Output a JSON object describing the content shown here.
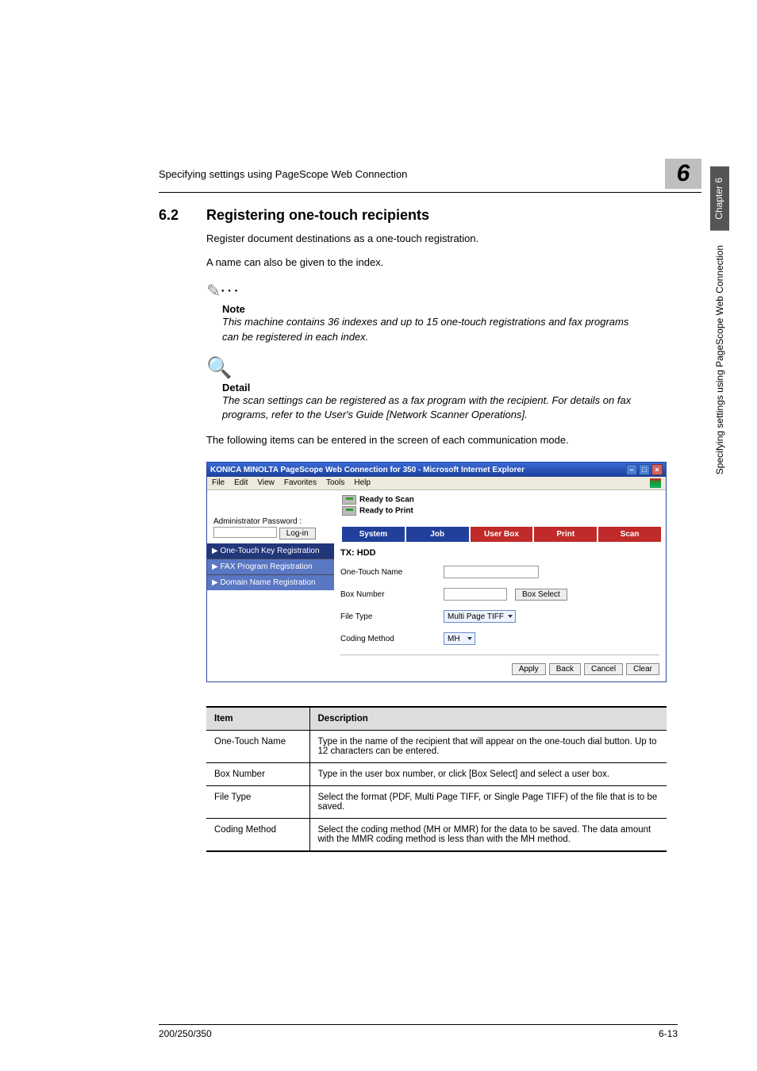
{
  "header": {
    "left": "Specifying settings using PageScope Web Connection",
    "chapter_num": "6"
  },
  "side": {
    "dark": "Chapter 6",
    "light": "Specifying settings using PageScope Web Connection"
  },
  "section": {
    "num": "6.2",
    "title": "Registering one-touch recipients"
  },
  "body1": "Register document destinations as a one-touch registration.",
  "body2": "A name can also be given to the index.",
  "note": {
    "head": "Note",
    "body": "This machine contains 36 indexes and up to 15 one-touch registrations and fax programs can be registered in each index."
  },
  "detail": {
    "head": "Detail",
    "body": "The scan settings can be registered as a fax program with the recipient. For details on fax programs, refer to the User's Guide [Network Scanner Operations]."
  },
  "body3": "The following items can be entered in the screen of each communication mode.",
  "browser": {
    "title": "KONICA MINOLTA PageScope Web Connection for 350 - Microsoft Internet Explorer",
    "menu": [
      "File",
      "Edit",
      "View",
      "Favorites",
      "Tools",
      "Help"
    ],
    "status1": "Ready to Scan",
    "status2": "Ready to Print",
    "admin_label": "Administrator Password :",
    "login": "Log-in",
    "tabs": {
      "sys": "System",
      "job": "Job",
      "user": "User Box",
      "print": "Print",
      "scan": "Scan"
    },
    "nav": {
      "a": "▶ One-Touch Key Registration",
      "b": "▶ FAX Program Registration",
      "c": "▶ Domain Name Registration"
    },
    "panel_title": "TX: HDD",
    "form": {
      "name_label": "One-Touch Name",
      "box_label": "Box Number",
      "box_button": "Box Select",
      "file_label": "File Type",
      "file_value": "Multi Page TIFF",
      "coding_label": "Coding Method",
      "coding_value": "MH"
    },
    "buttons": {
      "apply": "Apply",
      "back": "Back",
      "cancel": "Cancel",
      "clear": "Clear"
    }
  },
  "table": {
    "head_item": "Item",
    "head_desc": "Description",
    "rows": [
      {
        "item": "One-Touch Name",
        "desc": "Type in the name of the recipient that will appear on the one-touch dial button. Up to 12 characters can be entered."
      },
      {
        "item": "Box Number",
        "desc": "Type in the user box number, or click [Box Select] and select a user box."
      },
      {
        "item": "File Type",
        "desc": "Select the format (PDF, Multi Page TIFF, or Single Page TIFF) of the file that is to be saved."
      },
      {
        "item": "Coding Method",
        "desc": "Select the coding method (MH or MMR) for the data to be saved. The data amount with the MMR coding method is less than with the MH method."
      }
    ]
  },
  "footer": {
    "left": "200/250/350",
    "right": "6-13"
  },
  "chart_data": null
}
